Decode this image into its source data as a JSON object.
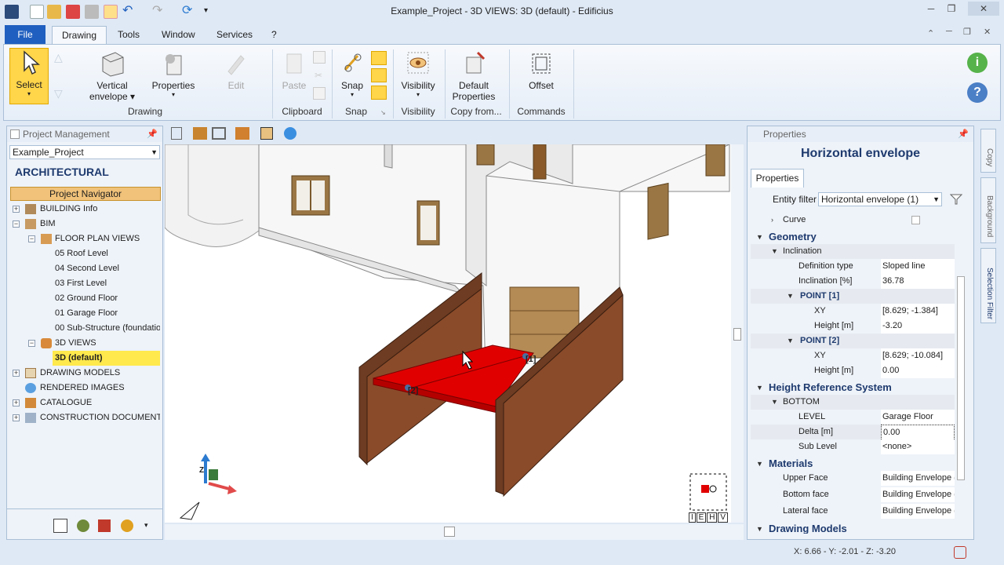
{
  "window": {
    "title": "Example_Project - 3D VIEWS: 3D (default) - Edificius"
  },
  "menu": {
    "file": "File",
    "tabs": [
      "Drawing",
      "Tools",
      "Window",
      "Services",
      "?"
    ]
  },
  "ribbon": {
    "select": "Select",
    "vertical_envelope_1": "Vertical",
    "vertical_envelope_2": "envelope",
    "properties": "Properties",
    "edit": "Edit",
    "paste": "Paste",
    "snap": "Snap",
    "visibility": "Visibility",
    "default_properties_1": "Default",
    "default_properties_2": "Properties",
    "offset": "Offset",
    "groups": {
      "drawing": "Drawing",
      "clipboard": "Clipboard",
      "snap": "Snap",
      "visibility": "Visibility",
      "copy_from": "Copy from...",
      "commands": "Commands"
    }
  },
  "project_panel": {
    "title": "Project Management",
    "project_select": "Example_Project",
    "section": "ARCHITECTURAL",
    "navigator": "Project Navigator",
    "tree": {
      "building_info": "BUILDING Info",
      "bim": "BIM",
      "floor_plan_views": "FLOOR PLAN VIEWS",
      "levels": [
        "05 Roof Level",
        "04 Second Level",
        "03 First Level",
        "02 Ground Floor",
        "01 Garage Floor",
        "00 Sub-Structure (foundatio"
      ],
      "views_3d": "3D VIEWS",
      "view_3d_default": "3D (default)",
      "drawing_models": "DRAWING MODELS",
      "rendered_images": "RENDERED IMAGES",
      "catalogue": "CATALOGUE",
      "construction_documents": "CONSTRUCTION DOCUMENTS S"
    }
  },
  "viewport": {
    "label_1": "[1]",
    "label_2": "[2]",
    "axis_z": "Z",
    "view_cube_letters": [
      "I",
      "E",
      "H",
      "V"
    ]
  },
  "properties_panel": {
    "header": "Properties",
    "title": "Horizontal envelope",
    "tab": "Properties",
    "entity_filter_label": "Entity filter",
    "entity_filter_value": "Horizontal envelope (1)",
    "rows": {
      "curve": "Curve",
      "geometry": "Geometry",
      "inclination": "Inclination",
      "definition_type_k": "Definition type",
      "definition_type_v": "Sloped line",
      "inclination_k": "Inclination  [%]",
      "inclination_v": "36.78",
      "point1": "POINT [1]",
      "xy1_k": "XY",
      "xy1_v": "[8.629; -1.384]",
      "height1_k": "Height  [m]",
      "height1_v": "-3.20",
      "point2": "POINT [2]",
      "xy2_k": "XY",
      "xy2_v": "[8.629; -10.084]",
      "height2_k": "Height  [m]",
      "height2_v": "0.00",
      "hrs": "Height Reference System",
      "bottom": "BOTTOM",
      "level_k": "LEVEL",
      "level_v": "Garage Floor",
      "delta_k": "Delta  [m]",
      "delta_v": "0.00",
      "sublevel_k": "Sub Level",
      "sublevel_v": "<none>",
      "materials": "Materials",
      "upper_face_k": "Upper Face",
      "upper_face_v": "Building Envelope (",
      "bottom_face_k": "Bottom face",
      "bottom_face_v": "Building Envelope (",
      "lateral_face_k": "Lateral face",
      "lateral_face_v": "Building Envelope (",
      "drawing_models": "Drawing Models"
    }
  },
  "side_tabs": [
    "Copy",
    "Background",
    "Selection Filter"
  ],
  "status": {
    "coords": "X: 6.66 - Y: -2.01 - Z: -3.20"
  },
  "colors": {
    "accent": "#1f5fbf",
    "highlight": "#ffe94d",
    "navigator": "#f0c27a",
    "selected_object": "#e10000"
  }
}
